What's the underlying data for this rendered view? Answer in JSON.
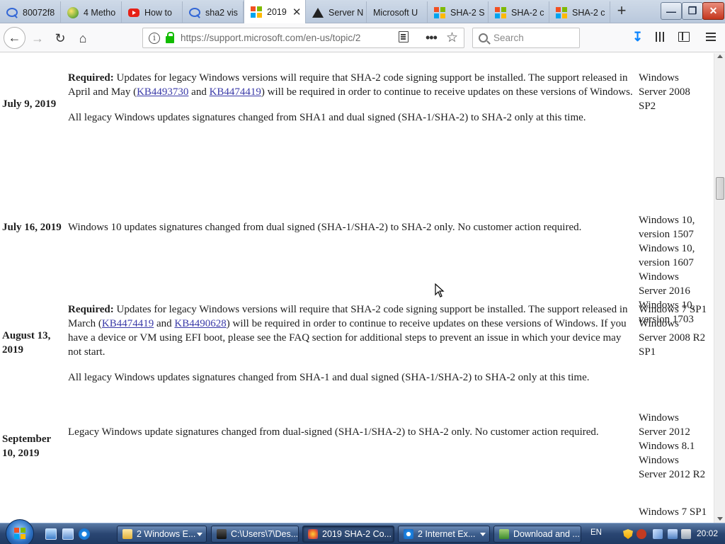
{
  "browser": {
    "tabs": [
      {
        "label": "80072f8",
        "icon": "google-search-icon",
        "active": false
      },
      {
        "label": "4 Metho",
        "icon": "site-favicon-icon",
        "active": false
      },
      {
        "label": "How to",
        "icon": "youtube-icon",
        "active": false
      },
      {
        "label": "sha2 vis",
        "icon": "google-search-icon",
        "active": false
      },
      {
        "label": "2019",
        "icon": "microsoft-icon",
        "active": true
      },
      {
        "label": "Server N",
        "icon": "warning-icon",
        "active": false
      },
      {
        "label": "Microsoft U",
        "icon": "none",
        "active": false
      },
      {
        "label": "SHA-2 S",
        "icon": "microsoft-icon",
        "active": false
      },
      {
        "label": "SHA-2 c",
        "icon": "microsoft-icon",
        "active": false
      },
      {
        "label": "SHA-2 c",
        "icon": "microsoft-icon",
        "active": false
      }
    ],
    "url": "https://support.microsoft.com/en-us/topic/2",
    "search_placeholder": "Search"
  },
  "rows": [
    {
      "date": "July 9, 2019",
      "paragraphs": [
        {
          "bold": "Required:",
          "parts": [
            " Updates for legacy Windows versions will require that SHA-2 code signing support be installed. The support released in April and May (",
            {
              "link": "KB4493730"
            },
            " and ",
            {
              "link": "KB4474419"
            },
            ") will be required in order to continue to receive updates on these versions of Windows."
          ]
        },
        {
          "bold": "",
          "parts": [
            "All legacy Windows updates signatures changed from SHA1 and dual signed (SHA-1/SHA-2) to SHA-2 only at this time."
          ]
        }
      ],
      "applies_to": [
        "Windows",
        "Server 2008",
        "SP2"
      ]
    },
    {
      "date": "July 16, 2019",
      "paragraphs": [
        {
          "bold": "",
          "parts": [
            "Windows 10 updates signatures changed from dual signed (SHA-1/SHA-2) to SHA-2 only. No customer action required."
          ]
        }
      ],
      "applies_to": [
        "Windows 10,",
        "version 1507",
        "Windows 10,",
        "version 1607",
        "Windows",
        "Server 2016",
        "Windows 10,",
        "version 1703"
      ]
    },
    {
      "date": "August 13, 2019",
      "paragraphs": [
        {
          "bold": "Required:",
          "parts": [
            " Updates for legacy Windows versions will require that SHA-2 code signing support be installed. The support released in March (",
            {
              "link": "KB4474419"
            },
            " and ",
            {
              "link": "KB4490628"
            },
            ") will be required in order to continue to receive updates on these versions of Windows. If you have a device or VM using EFI boot, please see the FAQ section for additional steps to prevent an issue in which your device may not start."
          ]
        },
        {
          "bold": "",
          "parts": [
            "All legacy Windows updates signatures changed from SHA-1 and dual signed (SHA-1/SHA-2) to SHA-2 only at this time."
          ]
        }
      ],
      "applies_to": [
        "Windows 7 SP1",
        "Windows",
        "Server 2008 R2",
        "SP1"
      ]
    },
    {
      "date": "September 10, 2019",
      "paragraphs": [
        {
          "bold": "",
          "parts": [
            "Legacy Windows update signatures changed from dual-signed (SHA-1/SHA-2) to SHA-2 only. No customer action required."
          ]
        }
      ],
      "applies_to": [
        "Windows",
        "Server 2012",
        "Windows 8.1",
        "Windows",
        "Server 2012 R2"
      ]
    },
    {
      "date": "",
      "paragraphs": [],
      "applies_to": [
        "Windows 7 SP1"
      ]
    }
  ],
  "taskbar": {
    "tasks": [
      {
        "label": "2 Windows E...",
        "icon": "folder-icon",
        "active": false,
        "group": true
      },
      {
        "label": "C:\\Users\\7\\Des...",
        "icon": "console-icon",
        "active": false,
        "group": false
      },
      {
        "label": "2019 SHA-2 Co...",
        "icon": "firefox-icon",
        "active": true,
        "group": false
      },
      {
        "label": "2 Internet Ex...",
        "icon": "ie-icon",
        "active": false,
        "group": true
      },
      {
        "label": "Download and ...",
        "icon": "download-manager-icon",
        "active": false,
        "group": false
      }
    ],
    "language": "EN",
    "clock": "20:02"
  }
}
